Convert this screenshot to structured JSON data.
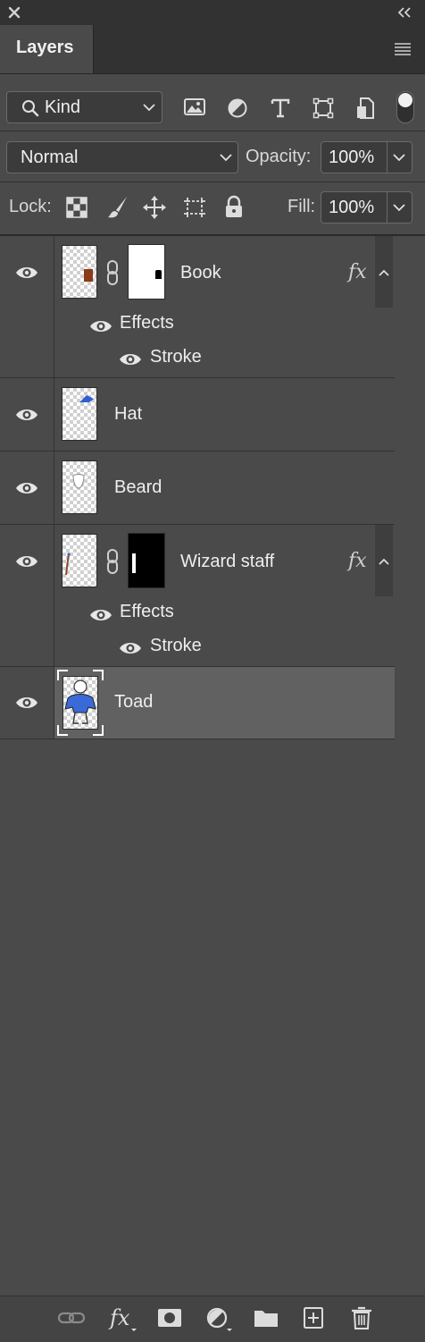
{
  "panel": {
    "tab_title": "Layers"
  },
  "filter": {
    "kind_label": "Kind"
  },
  "blend": {
    "mode": "Normal",
    "opacity_label": "Opacity:",
    "opacity_value": "100%"
  },
  "lock": {
    "label": "Lock:",
    "fill_label": "Fill:",
    "fill_value": "100%"
  },
  "layers": [
    {
      "name": "Book",
      "effects_label": "Effects",
      "stroke_label": "Stroke",
      "fx": "fx"
    },
    {
      "name": "Hat"
    },
    {
      "name": "Beard"
    },
    {
      "name": "Wizard staff",
      "effects_label": "Effects",
      "stroke_label": "Stroke",
      "fx": "fx"
    },
    {
      "name": "Toad",
      "selected": true
    }
  ],
  "bottom_icons": [
    "link-icon",
    "fx-icon",
    "mask-icon",
    "adjustment-icon",
    "folder-icon",
    "new-layer-icon",
    "trash-icon"
  ],
  "colors": {
    "panel_bg": "#4a4a4a",
    "header_bg": "#323232",
    "selected_row": "#616161",
    "text": "#e6e6e6"
  }
}
